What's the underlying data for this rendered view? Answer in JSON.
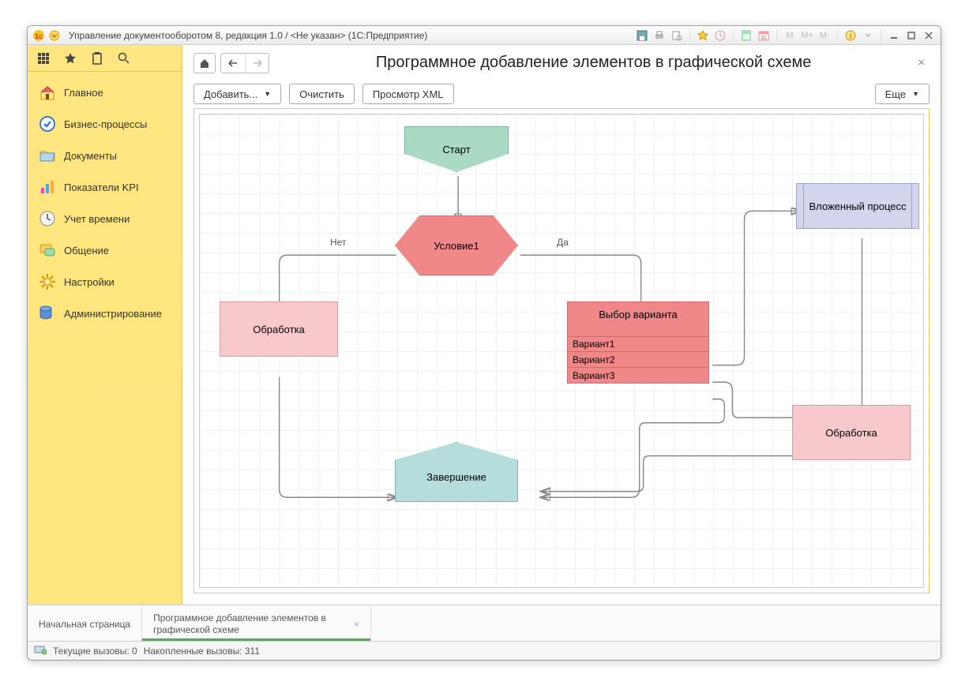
{
  "window": {
    "title": "Управление документооборотом 8, редакция 1.0 / <Не указан>  (1С:Предприятие)"
  },
  "sidebar": {
    "items": [
      {
        "label": "Главное"
      },
      {
        "label": "Бизнес-процессы"
      },
      {
        "label": "Документы"
      },
      {
        "label": "Показатели KPI"
      },
      {
        "label": "Учет времени"
      },
      {
        "label": "Общение"
      },
      {
        "label": "Настройки"
      },
      {
        "label": "Администрирование"
      }
    ]
  },
  "page": {
    "title": "Программное добавление элементов в графической схеме"
  },
  "toolbar": {
    "add": "Добавить...",
    "clear": "Очистить",
    "view_xml": "Просмотр XML",
    "more": "Еще"
  },
  "diagram": {
    "start": "Старт",
    "condition": "Условие1",
    "cond_no": "Нет",
    "cond_yes": "Да",
    "process_left": "Обработка",
    "choice_title": "Выбор варианта",
    "choice_opts": [
      "Вариант1",
      "Вариант2",
      "Вариант3"
    ],
    "subprocess": "Вложенный процесс",
    "process_right": "Обработка",
    "end": "Завершение"
  },
  "tabs": {
    "home": "Начальная страница",
    "page": "Программное добавление элементов в графической схеме"
  },
  "status": {
    "current": "Текущие вызовы: 0",
    "accum": "Накопленные вызовы: 311"
  },
  "titlebar_controls": {
    "m": "M",
    "mplus": "M+",
    "mminus": "M-"
  }
}
